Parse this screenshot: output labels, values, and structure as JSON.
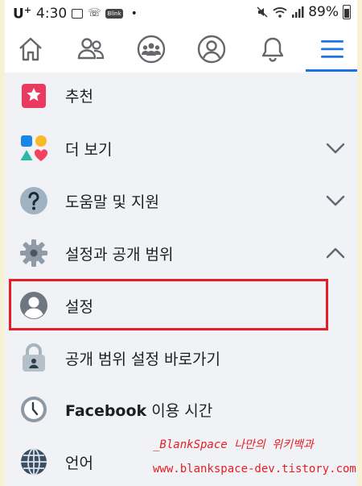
{
  "status_bar": {
    "carrier": "U",
    "carrier_plus": "+",
    "time": "4:30",
    "badge": "Blink",
    "battery": "89%"
  },
  "nav": {
    "items": [
      {
        "name": "home"
      },
      {
        "name": "friends"
      },
      {
        "name": "groups"
      },
      {
        "name": "profile"
      },
      {
        "name": "notifications"
      },
      {
        "name": "menu",
        "active": true
      }
    ],
    "active_color": "#1b74e4"
  },
  "menu": {
    "items": [
      {
        "label": "추천",
        "icon": "recommend-icon",
        "chevron": "none"
      },
      {
        "label": "더 보기",
        "icon": "see-more-icon",
        "chevron": "down"
      },
      {
        "label": "도움말 및 지원",
        "icon": "help-icon",
        "chevron": "down"
      },
      {
        "label": "설정과 공개 범위",
        "icon": "gear-icon",
        "chevron": "up"
      },
      {
        "label": "설정",
        "icon": "account-icon",
        "chevron": "none",
        "highlighted": true
      },
      {
        "label": "공개 범위 설정 바로가기",
        "icon": "lock-icon",
        "chevron": "none"
      },
      {
        "label_bold": "Facebook",
        "label_rest": " 이용 시간",
        "icon": "clock-icon",
        "chevron": "none"
      },
      {
        "label": "언어",
        "icon": "globe-icon",
        "chevron": "none"
      }
    ]
  },
  "watermark": {
    "line1": "_BlankSpace 나만의 위키백과",
    "line2": "www.blankspace-dev.tistory.com",
    "color": "#e31e24"
  }
}
